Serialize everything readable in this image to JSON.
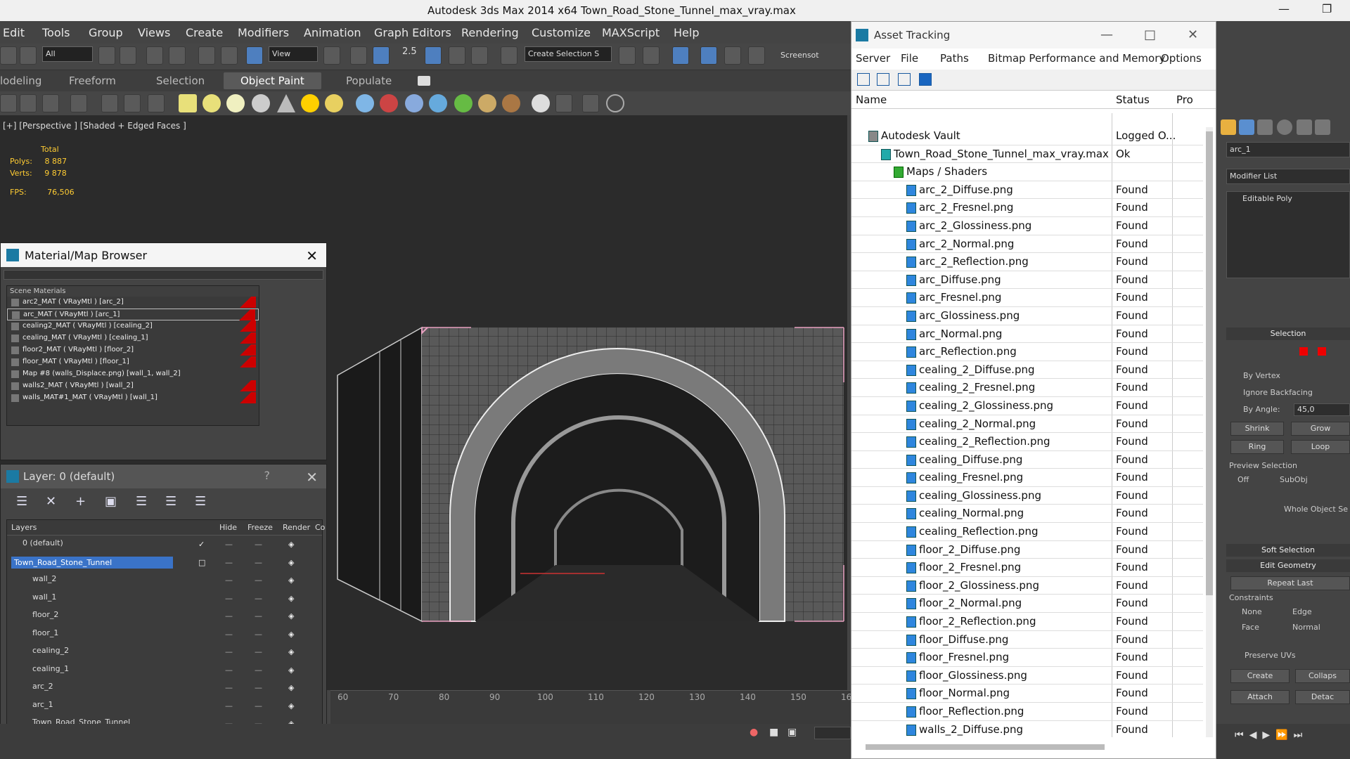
{
  "titlebar": {
    "title": "Autodesk 3ds Max  2014 x64      Town_Road_Stone_Tunnel_max_vray.max"
  },
  "menu": [
    "Edit",
    "Tools",
    "Group",
    "Views",
    "Create",
    "Modifiers",
    "Animation",
    "Graph Editors",
    "Rendering",
    "Customize",
    "MAXScript",
    "Help"
  ],
  "toolbar": {
    "filter": "All",
    "ref_coord": "View",
    "named_sel": "Create Selection S",
    "snap_value": "2.5",
    "screenshot": "Screensot"
  },
  "ribbon": [
    "lodeling",
    "Freeform",
    "Selection",
    "Object Paint",
    "Populate"
  ],
  "ribbon_active": "Object Paint",
  "viewport": {
    "label": "[+] [Perspective ] [Shaded + Edged Faces ]",
    "stats_title": "Total",
    "polys_label": "Polys:",
    "polys": "8 887",
    "verts_label": "Verts:",
    "verts": "9 878",
    "fps_label": "FPS:",
    "fps": "76,506"
  },
  "material_browser": {
    "title": "Material/Map Browser",
    "group": "Scene Materials",
    "items": [
      "arc2_MAT ( VRayMtl ) [arc_2]",
      "arc_MAT ( VRayMtl ) [arc_1]",
      "cealing2_MAT ( VRayMtl ) [cealing_2]",
      "cealing_MAT ( VRayMtl ) [cealing_1]",
      "floor2_MAT ( VRayMtl ) [floor_2]",
      "floor_MAT ( VRayMtl ) [floor_1]",
      "Map #8 (walls_Displace.png) [wall_1, wall_2]",
      "walls2_MAT ( VRayMtl ) [wall_2]",
      "walls_MAT#1_MAT ( VRayMtl ) [wall_1]"
    ]
  },
  "layer_manager": {
    "title": "Layer: 0 (default)",
    "help": "?",
    "columns": [
      "Layers",
      "Hide",
      "Freeze",
      "Render",
      "Co"
    ],
    "rows": [
      "0 (default)",
      "Town_Road_Stone_Tunnel",
      "wall_2",
      "wall_1",
      "floor_2",
      "floor_1",
      "cealing_2",
      "cealing_1",
      "arc_2",
      "arc_1",
      "Town_Road_Stone_Tunnel"
    ]
  },
  "timeline": {
    "ticks": [
      "60",
      "70",
      "80",
      "90",
      "100",
      "110",
      "120",
      "130",
      "140",
      "150",
      "16"
    ]
  },
  "asset_tracking": {
    "title": "Asset Tracking",
    "menu": [
      "Server",
      "File",
      "Paths",
      "Bitmap Performance and Memory",
      "Options"
    ],
    "columns": [
      "Name",
      "Status",
      "Pro"
    ],
    "rows": [
      {
        "name": "Autodesk Vault",
        "status": "Logged O..."
      },
      {
        "name": "Town_Road_Stone_Tunnel_max_vray.max",
        "status": "Ok"
      },
      {
        "name": "Maps / Shaders",
        "status": ""
      },
      {
        "name": "arc_2_Diffuse.png",
        "status": "Found"
      },
      {
        "name": "arc_2_Fresnel.png",
        "status": "Found"
      },
      {
        "name": "arc_2_Glossiness.png",
        "status": "Found"
      },
      {
        "name": "arc_2_Normal.png",
        "status": "Found"
      },
      {
        "name": "arc_2_Reflection.png",
        "status": "Found"
      },
      {
        "name": "arc_Diffuse.png",
        "status": "Found"
      },
      {
        "name": "arc_Fresnel.png",
        "status": "Found"
      },
      {
        "name": "arc_Glossiness.png",
        "status": "Found"
      },
      {
        "name": "arc_Normal.png",
        "status": "Found"
      },
      {
        "name": "arc_Reflection.png",
        "status": "Found"
      },
      {
        "name": "cealing_2_Diffuse.png",
        "status": "Found"
      },
      {
        "name": "cealing_2_Fresnel.png",
        "status": "Found"
      },
      {
        "name": "cealing_2_Glossiness.png",
        "status": "Found"
      },
      {
        "name": "cealing_2_Normal.png",
        "status": "Found"
      },
      {
        "name": "cealing_2_Reflection.png",
        "status": "Found"
      },
      {
        "name": "cealing_Diffuse.png",
        "status": "Found"
      },
      {
        "name": "cealing_Fresnel.png",
        "status": "Found"
      },
      {
        "name": "cealing_Glossiness.png",
        "status": "Found"
      },
      {
        "name": "cealing_Normal.png",
        "status": "Found"
      },
      {
        "name": "cealing_Reflection.png",
        "status": "Found"
      },
      {
        "name": "floor_2_Diffuse.png",
        "status": "Found"
      },
      {
        "name": "floor_2_Fresnel.png",
        "status": "Found"
      },
      {
        "name": "floor_2_Glossiness.png",
        "status": "Found"
      },
      {
        "name": "floor_2_Normal.png",
        "status": "Found"
      },
      {
        "name": "floor_2_Reflection.png",
        "status": "Found"
      },
      {
        "name": "floor_Diffuse.png",
        "status": "Found"
      },
      {
        "name": "floor_Fresnel.png",
        "status": "Found"
      },
      {
        "name": "floor_Glossiness.png",
        "status": "Found"
      },
      {
        "name": "floor_Normal.png",
        "status": "Found"
      },
      {
        "name": "floor_Reflection.png",
        "status": "Found"
      },
      {
        "name": "walls_2_Diffuse.png",
        "status": "Found"
      }
    ]
  },
  "command_panel": {
    "object_name": "arc_1",
    "modifier_list": "Modifier List",
    "stack_item": "Editable Poly",
    "selection_title": "Selection",
    "by_vertex": "By Vertex",
    "ignore_backfacing": "Ignore Backfacing",
    "by_angle": "By Angle:",
    "angle_value": "45,0",
    "shrink": "Shrink",
    "grow": "Grow",
    "ring": "Ring",
    "loop": "Loop",
    "preview_selection": "Preview Selection",
    "off": "Off",
    "subobj": "SubObj",
    "whole_object": "Whole Object Se",
    "soft_selection": "Soft Selection",
    "edit_geometry": "Edit Geometry",
    "repeat_last": "Repeat Last",
    "constraints": "Constraints",
    "none": "None",
    "edge": "Edge",
    "face": "Face",
    "normal": "Normal",
    "preserve_uvs": "Preserve UVs",
    "create": "Create",
    "collapse": "Collaps",
    "attach": "Attach",
    "detach": "Detac"
  },
  "colors": {
    "accent_blue": "#3a73c8",
    "found_icon": "#2e86de",
    "gizmo_pink": "#e8a0c0"
  }
}
